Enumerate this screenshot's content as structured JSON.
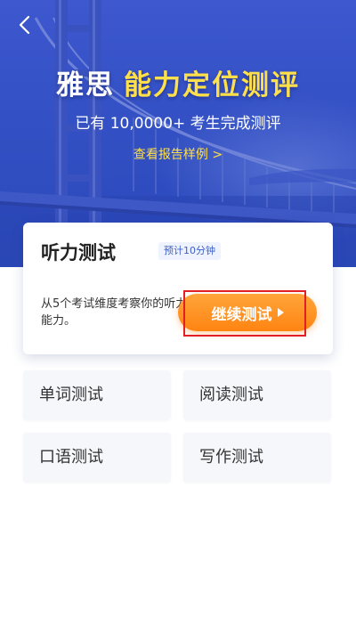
{
  "header": {
    "back_icon": "chevron-left-icon"
  },
  "hero": {
    "title_white": "雅思",
    "title_yellow": "能力定位测评",
    "subtitle": "已有 10,0000+ 考生完成测评",
    "report_link": "查看报告样例 >",
    "colors": {
      "background": "#3350c4",
      "accent_yellow": "#ffe04a"
    }
  },
  "main_card": {
    "title": "听力测试",
    "time_badge": "预计10分钟",
    "description": "从5个考试维度考察你的听力能力。",
    "continue_button": "继续测试",
    "continue_icon": "play-triangle-icon",
    "colors": {
      "button": "#ff8e1f",
      "highlight_border": "#e21f26"
    }
  },
  "tests": [
    {
      "label": "单词测试"
    },
    {
      "label": "阅读测试"
    },
    {
      "label": "口语测试"
    },
    {
      "label": "写作测试"
    }
  ]
}
